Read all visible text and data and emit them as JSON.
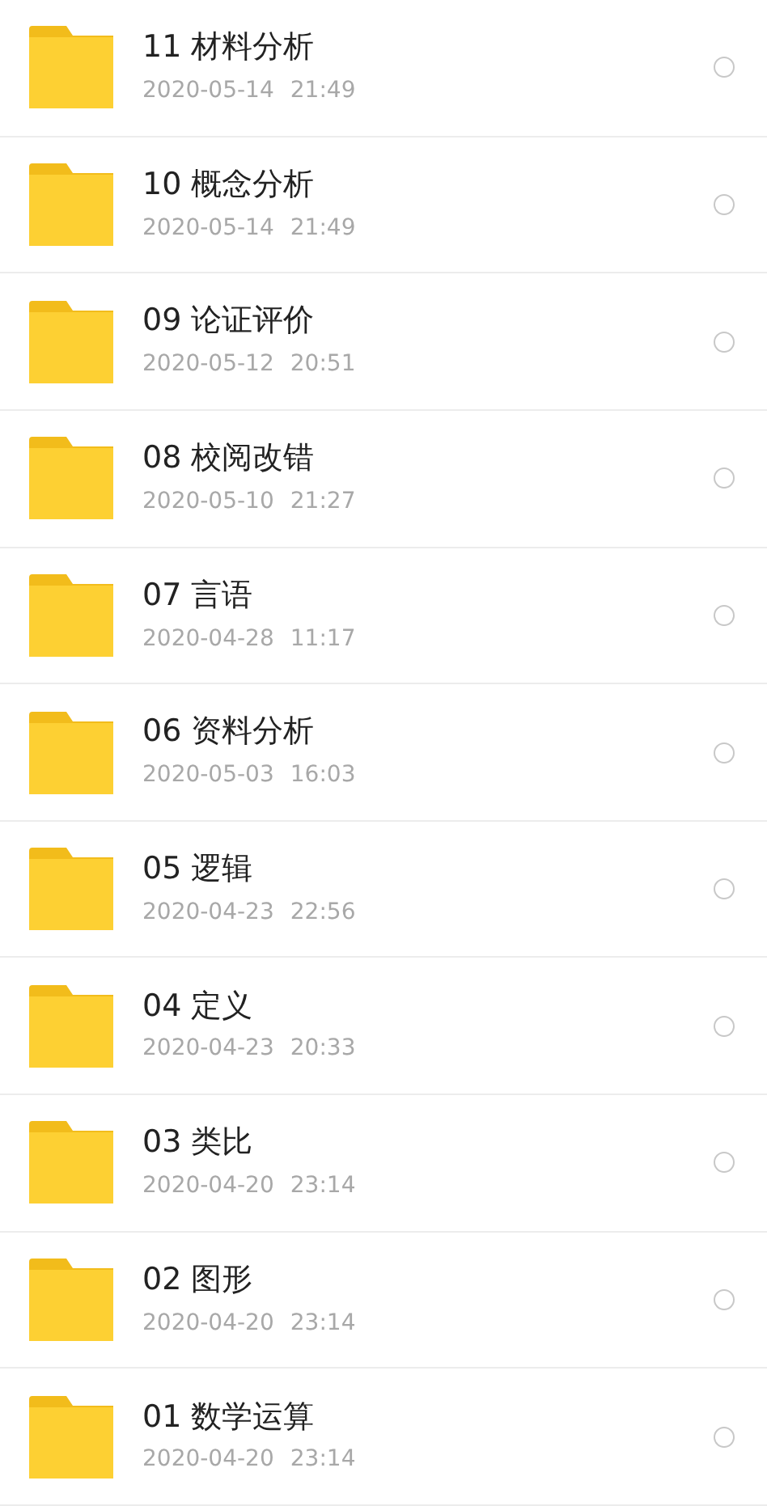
{
  "folders": [
    {
      "name": "11 材料分析",
      "date": "2020-05-14",
      "time": "21:49",
      "selected": false
    },
    {
      "name": "10 概念分析",
      "date": "2020-05-14",
      "time": "21:49",
      "selected": false
    },
    {
      "name": "09 论证评价",
      "date": "2020-05-12",
      "time": "20:51",
      "selected": false
    },
    {
      "name": "08 校阅改错",
      "date": "2020-05-10",
      "time": "21:27",
      "selected": false
    },
    {
      "name": "07 言语",
      "date": "2020-04-28",
      "time": "11:17",
      "selected": false
    },
    {
      "name": "06 资料分析",
      "date": "2020-05-03",
      "time": "16:03",
      "selected": false
    },
    {
      "name": "05 逻辑",
      "date": "2020-04-23",
      "time": "22:56",
      "selected": false
    },
    {
      "name": "04 定义",
      "date": "2020-04-23",
      "time": "20:33",
      "selected": false
    },
    {
      "name": "03 类比",
      "date": "2020-04-20",
      "time": "23:14",
      "selected": false
    },
    {
      "name": "02 图形",
      "date": "2020-04-20",
      "time": "23:14",
      "selected": false
    },
    {
      "name": "01 数学运算",
      "date": "2020-04-20",
      "time": "23:14",
      "selected": false
    }
  ]
}
